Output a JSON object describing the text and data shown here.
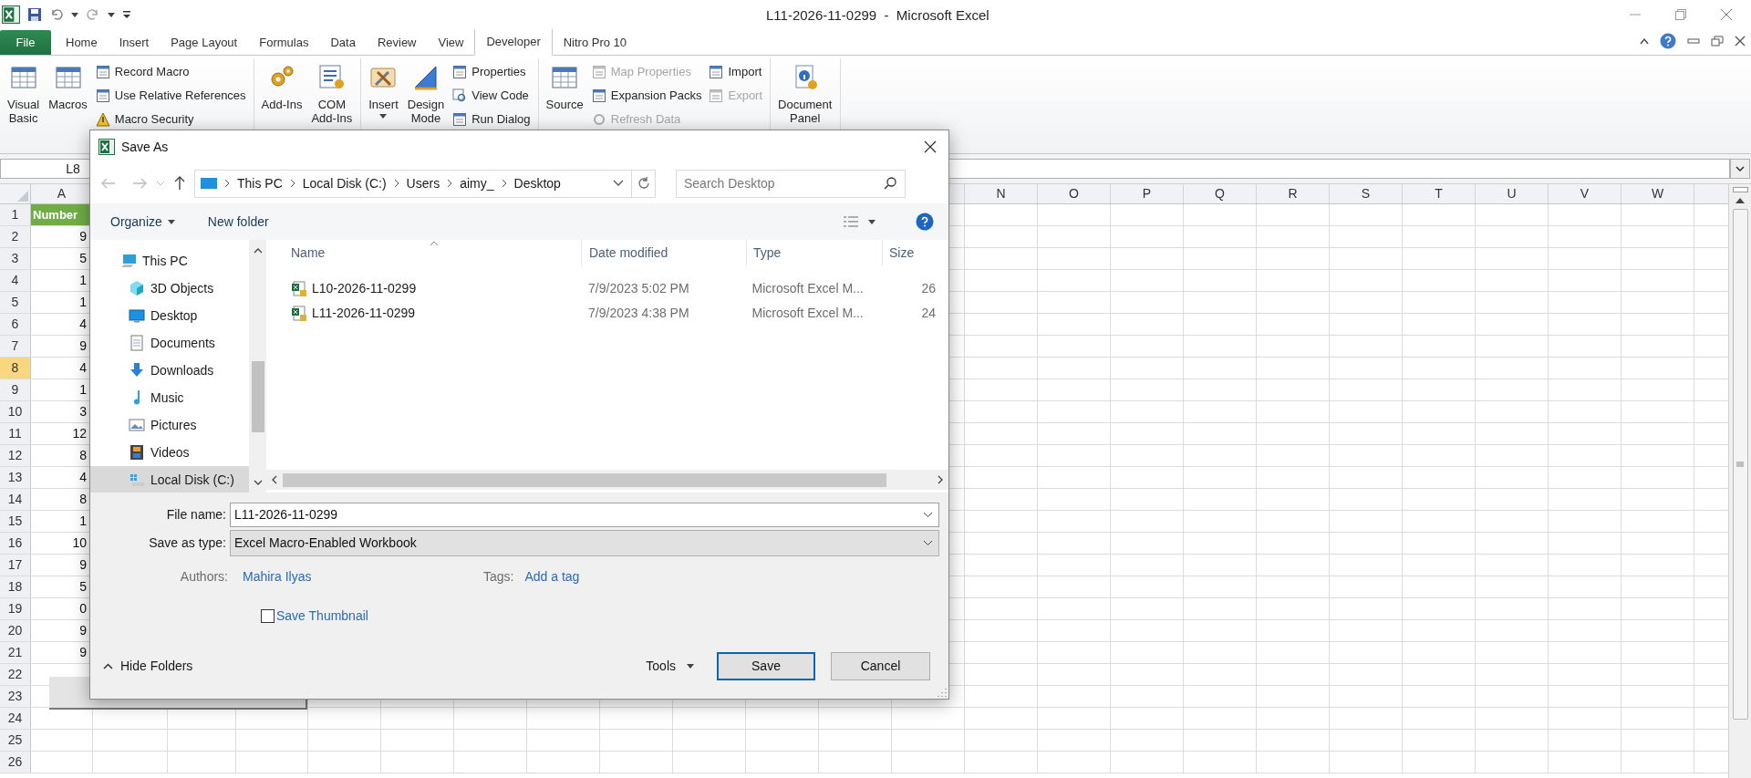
{
  "window": {
    "title": "L11-2026-11-0299  -  Microsoft Excel"
  },
  "ribbon_tabs": [
    {
      "label": "File",
      "kind": "file",
      "selected": false
    },
    {
      "label": "Home",
      "kind": "tab",
      "selected": false
    },
    {
      "label": "Insert",
      "kind": "tab",
      "selected": false
    },
    {
      "label": "Page Layout",
      "kind": "tab",
      "selected": false
    },
    {
      "label": "Formulas",
      "kind": "tab",
      "selected": false
    },
    {
      "label": "Data",
      "kind": "tab",
      "selected": false
    },
    {
      "label": "Review",
      "kind": "tab",
      "selected": false
    },
    {
      "label": "View",
      "kind": "tab",
      "selected": false
    },
    {
      "label": "Developer",
      "kind": "tab",
      "selected": true
    },
    {
      "label": "Nitro Pro 10",
      "kind": "tab",
      "selected": false
    }
  ],
  "ribbon_groups": [
    {
      "items": [
        {
          "kind": "large",
          "label": "Visual Basic",
          "disabled": false
        },
        {
          "kind": "large",
          "label": "Macros",
          "disabled": false
        },
        {
          "kind": "small",
          "label": "Record Macro",
          "disabled": false
        },
        {
          "kind": "small",
          "label": "Use Relative References",
          "disabled": false
        },
        {
          "kind": "small",
          "label": "Macro Security",
          "disabled": false
        }
      ]
    },
    {
      "items": [
        {
          "kind": "large",
          "label": "Add-Ins",
          "disabled": false
        },
        {
          "kind": "large",
          "label": "COM Add-Ins",
          "disabled": false
        }
      ]
    },
    {
      "items": [
        {
          "kind": "large-dropdown",
          "label": "Insert",
          "disabled": false
        },
        {
          "kind": "large",
          "label": "Design Mode",
          "disabled": false
        },
        {
          "kind": "small",
          "label": "Properties",
          "disabled": false
        },
        {
          "kind": "small",
          "label": "View Code",
          "disabled": false
        },
        {
          "kind": "small",
          "label": "Run Dialog",
          "disabled": false
        }
      ]
    },
    {
      "items": [
        {
          "kind": "large",
          "label": "Source",
          "disabled": false
        },
        {
          "kind": "small",
          "label": "Map Properties",
          "disabled": true
        },
        {
          "kind": "small",
          "label": "Expansion Packs",
          "disabled": false
        },
        {
          "kind": "small",
          "label": "Refresh Data",
          "disabled": true
        },
        {
          "kind": "small",
          "label": "Import",
          "disabled": false
        },
        {
          "kind": "small",
          "label": "Export",
          "disabled": true
        }
      ]
    },
    {
      "items": [
        {
          "kind": "large",
          "label": "Document Panel",
          "disabled": false
        }
      ]
    }
  ],
  "name_box": "L8",
  "sheet": {
    "columns": [
      {
        "label": "A"
      },
      {
        "label": "N"
      },
      {
        "label": "O"
      },
      {
        "label": "P"
      },
      {
        "label": "Q"
      },
      {
        "label": "R"
      },
      {
        "label": "S"
      },
      {
        "label": "T"
      },
      {
        "label": "U"
      },
      {
        "label": "V"
      },
      {
        "label": "W"
      }
    ],
    "rows": [
      {
        "number": "1",
        "selected": false,
        "kind": "header",
        "cell": "Number"
      },
      {
        "number": "2",
        "selected": false,
        "cell": "9"
      },
      {
        "number": "3",
        "selected": false,
        "cell": "5"
      },
      {
        "number": "4",
        "selected": false,
        "cell": "1"
      },
      {
        "number": "5",
        "selected": false,
        "cell": "1"
      },
      {
        "number": "6",
        "selected": false,
        "cell": "4"
      },
      {
        "number": "7",
        "selected": false,
        "cell": "9"
      },
      {
        "number": "8",
        "selected": true,
        "cell": "4"
      },
      {
        "number": "9",
        "selected": false,
        "cell": "1"
      },
      {
        "number": "10",
        "selected": false,
        "cell": "3"
      },
      {
        "number": "11",
        "selected": false,
        "cell": "12"
      },
      {
        "number": "12",
        "selected": false,
        "cell": "8"
      },
      {
        "number": "13",
        "selected": false,
        "cell": "4"
      },
      {
        "number": "14",
        "selected": false,
        "cell": "8"
      },
      {
        "number": "15",
        "selected": false,
        "cell": "1"
      },
      {
        "number": "16",
        "selected": false,
        "cell": "10"
      },
      {
        "number": "17",
        "selected": false,
        "cell": "9"
      },
      {
        "number": "18",
        "selected": false,
        "cell": "5"
      },
      {
        "number": "19",
        "selected": false,
        "cell": "0"
      },
      {
        "number": "20",
        "selected": false,
        "cell": "9"
      },
      {
        "number": "21",
        "selected": false,
        "cell": "9"
      },
      {
        "number": "22",
        "selected": false
      },
      {
        "number": "23",
        "selected": false
      },
      {
        "number": "24",
        "selected": false
      },
      {
        "number": "25",
        "selected": false
      },
      {
        "number": "26",
        "selected": false
      }
    ]
  },
  "dialog": {
    "title": "Save As",
    "breadcrumb": [
      "This PC",
      "Local Disk (C:)",
      "Users",
      "aimy_",
      "Desktop"
    ],
    "search": {
      "placeholder": "Search Desktop"
    },
    "toolbar": [
      {
        "label": "Organize",
        "kind": "menu"
      },
      {
        "label": "New folder",
        "kind": "button"
      }
    ],
    "nav": [
      {
        "label": "This PC",
        "selected": false,
        "children": [
          {
            "label": "3D Objects",
            "selected": false
          },
          {
            "label": "Desktop",
            "selected": false
          },
          {
            "label": "Documents",
            "selected": false
          },
          {
            "label": "Downloads",
            "selected": false
          },
          {
            "label": "Music",
            "selected": false
          },
          {
            "label": "Pictures",
            "selected": false
          },
          {
            "label": "Videos",
            "selected": false
          },
          {
            "label": "Local Disk (C:)",
            "selected": true
          }
        ]
      }
    ],
    "columns": [
      "Name",
      "Date modified",
      "Type",
      "Size"
    ],
    "files": [
      {
        "name": "L10-2026-11-0299",
        "date": "7/9/2023 5:02 PM",
        "type": "Microsoft Excel M...",
        "size": "26"
      },
      {
        "name": "L11-2026-11-0299",
        "date": "7/9/2023 4:38 PM",
        "type": "Microsoft Excel M...",
        "size": "24"
      }
    ],
    "file_name": {
      "label": "File name:",
      "value": "L11-2026-11-0299"
    },
    "save_as_type": {
      "label": "Save as type:",
      "value": "Excel Macro-Enabled Workbook"
    },
    "authors": {
      "label": "Authors:",
      "value": "Mahira Ilyas"
    },
    "tags": {
      "label": "Tags:",
      "value": "Add a tag"
    },
    "save_thumbnail": {
      "label": "Save Thumbnail",
      "checked": false
    },
    "hide_folders": "Hide Folders",
    "tools": "Tools",
    "save": "Save",
    "cancel": "Cancel"
  }
}
